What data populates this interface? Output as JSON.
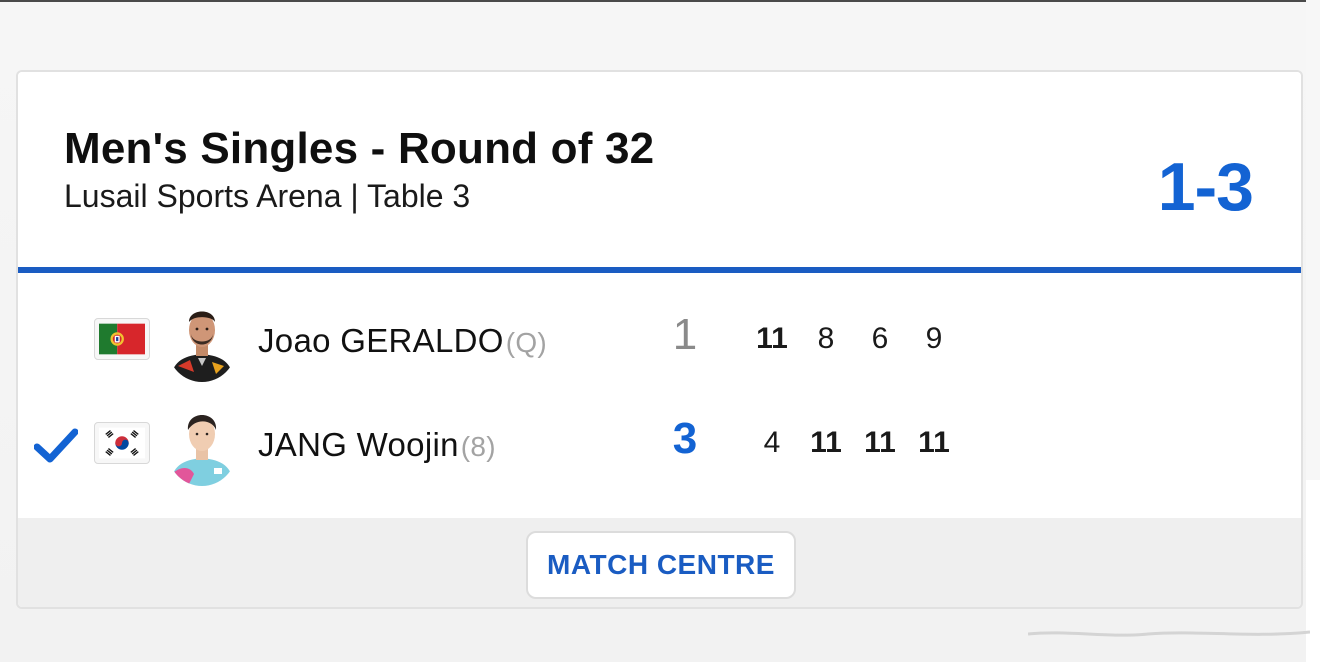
{
  "match": {
    "event_title": "Men's Singles - Round of 32",
    "venue_line": "Lusail Sports Arena | Table 3",
    "score": "1-3"
  },
  "players": [
    {
      "name": "Joao GERALDO",
      "seed": "(Q)",
      "games_won": "1",
      "game_scores": [
        "11",
        "8",
        "6",
        "9"
      ],
      "games_won_flags": [
        true,
        false,
        false,
        false
      ],
      "is_winner": false,
      "flag_icon": "portugal-flag-icon"
    },
    {
      "name": "JANG Woojin",
      "seed": "(8)",
      "games_won": "3",
      "game_scores": [
        "4",
        "11",
        "11",
        "11"
      ],
      "games_won_flags": [
        false,
        true,
        true,
        true
      ],
      "is_winner": true,
      "flag_icon": "south-korea-flag-icon"
    }
  ],
  "footer": {
    "match_centre_label": "MATCH CENTRE"
  },
  "icons": {
    "winner": "checkmark-icon",
    "avatar": "player-photo"
  },
  "colors": {
    "accent": "#1363d3",
    "rule": "#1a5cc2",
    "loser_score": "#8a8a8a",
    "seed": "#a3a3a3",
    "footer_bg": "#efefef"
  }
}
